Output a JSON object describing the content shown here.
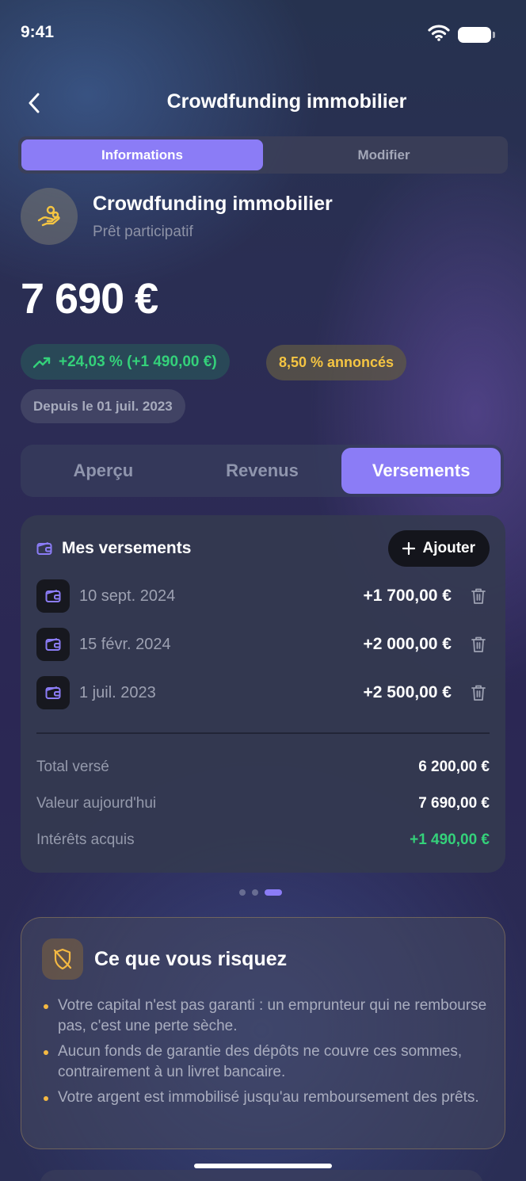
{
  "status_bar": {
    "time": "9:41"
  },
  "header": {
    "title": "Crowdfunding immobilier"
  },
  "segmented": {
    "items": [
      "Informations",
      "Modifier"
    ],
    "active": 0
  },
  "product": {
    "name": "Crowdfunding immobilier",
    "subtitle": "Prêt participatif",
    "amount": "7 690 €",
    "performance": "+24,03 % (+1 490,00 €)",
    "rate": "8,50 % annoncés",
    "since": "Depuis le 01 juil. 2023"
  },
  "tabs": {
    "items": [
      "Aperçu",
      "Revenus",
      "Versements"
    ],
    "active": 2
  },
  "payments": {
    "title": "Mes versements",
    "add_label": "Ajouter",
    "rows": [
      {
        "date": "10 sept. 2024",
        "amount": "+1 700,00 €"
      },
      {
        "date": "15 févr. 2024",
        "amount": "+2 000,00 €"
      },
      {
        "date": "1 juil. 2023",
        "amount": "+2 500,00 €"
      }
    ],
    "summary": [
      {
        "label": "Total versé",
        "value": "6 200,00 €"
      },
      {
        "label": "Valeur aujourd'hui",
        "value": "7 690,00 €"
      },
      {
        "label": "Intérêts acquis",
        "value": "+1 490,00 €"
      }
    ]
  },
  "pager": {
    "count": 3,
    "active": 2
  },
  "risk": {
    "title": "Ce que vous risquez",
    "items": [
      "Votre capital n'est pas garanti : un emprunteur qui ne rembourse pas, c'est une perte sèche.",
      "Aucun fonds de garantie des dépôts ne couvre ces sommes, contrairement à un livret bancaire.",
      "Votre argent est immobilisé jusqu'au remboursement des prêts."
    ]
  },
  "colors": {
    "accent": "#8b7cf6",
    "positive": "#34d17a",
    "warning": "#f5c542"
  },
  "icons": [
    "wifi-icon",
    "battery-icon",
    "chevron-left-icon",
    "hand-coins-icon",
    "trend-up-icon",
    "wallet-icon",
    "plus-icon",
    "trash-icon",
    "shield-off-icon"
  ]
}
